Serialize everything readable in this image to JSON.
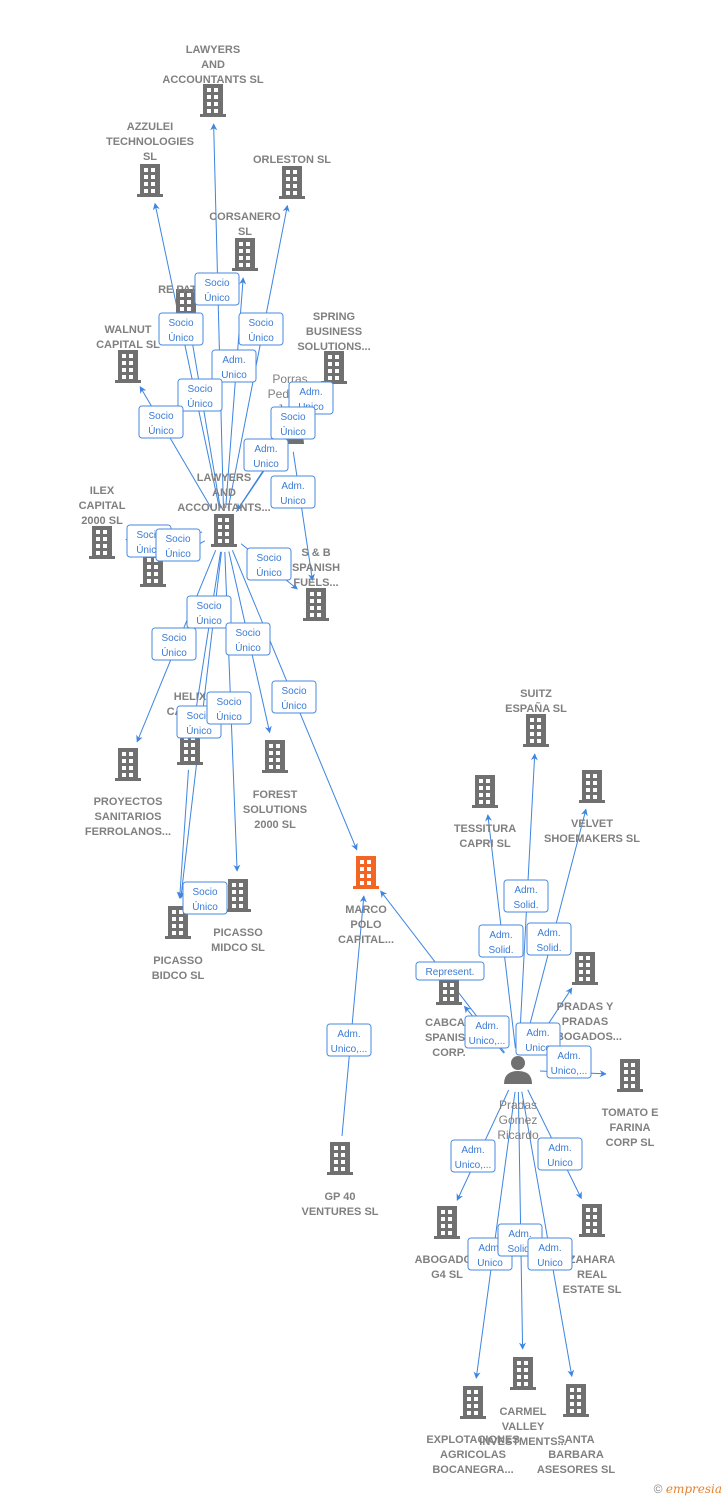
{
  "colors": {
    "node": "#707070",
    "highlight": "#f26522",
    "edge": "#3d85e0"
  },
  "nodes": [
    {
      "id": "lawyers_top",
      "type": "company",
      "lines": [
        "LAWYERS",
        "AND",
        "ACCOUNTANTS SL"
      ]
    },
    {
      "id": "azzulei",
      "type": "company",
      "lines": [
        "AZZULEI",
        "TECHNOLOGIES",
        "SL"
      ]
    },
    {
      "id": "orleston",
      "type": "company",
      "lines": [
        "ORLESTON  SL"
      ]
    },
    {
      "id": "corsanero",
      "type": "company",
      "lines": [
        "CORSANERO",
        "SL"
      ]
    },
    {
      "id": "repat",
      "type": "company",
      "lines": [
        "RE PAT SL"
      ]
    },
    {
      "id": "walnut",
      "type": "company",
      "lines": [
        "WALNUT",
        "CAPITAL  SL"
      ]
    },
    {
      "id": "spring",
      "type": "company",
      "lines": [
        "SPRING",
        "BUSINESS",
        "SOLUTIONS..."
      ]
    },
    {
      "id": "porras",
      "type": "person",
      "lines": [
        "Porras",
        "Pedraza",
        "Juan"
      ]
    },
    {
      "id": "lawyers_mid",
      "type": "company",
      "lines": [
        "LAWYERS",
        "AND",
        "ACCOUNTANTS..."
      ]
    },
    {
      "id": "ilex",
      "type": "company",
      "lines": [
        "ILEX",
        "CAPITAL",
        "2000  SL"
      ]
    },
    {
      "id": "weston",
      "type": "company",
      "lines": [
        "WESTON"
      ]
    },
    {
      "id": "sb",
      "type": "company",
      "lines": [
        "S & B",
        "SPANISH",
        "FUELS..."
      ]
    },
    {
      "id": "helix",
      "type": "company",
      "lines": [
        "HELIX",
        "CAPITAL",
        "2000"
      ]
    },
    {
      "id": "proyectos",
      "type": "company",
      "lines": [
        "PROYECTOS",
        "SANITARIOS",
        "FERROLANOS..."
      ]
    },
    {
      "id": "forest",
      "type": "company",
      "lines": [
        "FOREST",
        "SOLUTIONS",
        "2000  SL"
      ]
    },
    {
      "id": "picasso_midco",
      "type": "company",
      "lines": [
        "PICASSO",
        "MIDCO  SL"
      ]
    },
    {
      "id": "picasso_bidco",
      "type": "company",
      "lines": [
        "PICASSO",
        "BIDCO  SL"
      ]
    },
    {
      "id": "marco",
      "type": "company",
      "highlight": true,
      "lines": [
        "MARCO",
        "POLO",
        "CAPITAL..."
      ]
    },
    {
      "id": "gp40",
      "type": "company",
      "lines": [
        "GP 40",
        "VENTURES  SL"
      ]
    },
    {
      "id": "suitz",
      "type": "company",
      "lines": [
        "SUITZ",
        "ESPAÑA  SL"
      ]
    },
    {
      "id": "tessitura",
      "type": "company",
      "lines": [
        "TESSITURA",
        "CAPRI  SL"
      ]
    },
    {
      "id": "velvet",
      "type": "company",
      "lines": [
        "VELVET",
        "SHOEMAKERS SL"
      ]
    },
    {
      "id": "pradas_y",
      "type": "company",
      "lines": [
        "PRADAS Y",
        "PRADAS",
        "ABOGADOS..."
      ]
    },
    {
      "id": "cabcar",
      "type": "company",
      "lines": [
        "CABCAR",
        "SPANISH",
        "CORP."
      ]
    },
    {
      "id": "pradas_gomez",
      "type": "person",
      "lines": [
        "Pradas",
        "Gomez",
        "Ricardo"
      ]
    },
    {
      "id": "tomato",
      "type": "company",
      "lines": [
        "TOMATO E",
        "FARINA",
        "CORP  SL"
      ]
    },
    {
      "id": "abogado",
      "type": "company",
      "lines": [
        "ABOGADOS",
        "G4  SL"
      ]
    },
    {
      "id": "zahara",
      "type": "company",
      "lines": [
        "ZAHARA",
        "REAL",
        "ESTATE  SL"
      ]
    },
    {
      "id": "carmel",
      "type": "company",
      "lines": [
        "CARMEL",
        "VALLEY",
        "INVESTMENTS..."
      ]
    },
    {
      "id": "explotaciones",
      "type": "company",
      "lines": [
        "EXPLOTACIONES",
        "AGRICOLAS",
        "BOCANEGRA..."
      ]
    },
    {
      "id": "santa",
      "type": "company",
      "lines": [
        "SANTA",
        "BARBARA",
        "ASESORES  SL"
      ]
    }
  ],
  "edges": [
    {
      "from": "lawyers_mid",
      "to": "lawyers_top",
      "lines": [
        "Socio",
        "Único"
      ]
    },
    {
      "from": "lawyers_mid",
      "to": "azzulei",
      "lines": [
        "Socio",
        "Único"
      ]
    },
    {
      "from": "lawyers_mid",
      "to": "orleston",
      "lines": [
        "Socio",
        "Único"
      ]
    },
    {
      "from": "lawyers_mid",
      "to": "corsanero",
      "lines": [
        "Adm.",
        "Unico"
      ]
    },
    {
      "from": "lawyers_mid",
      "to": "repat",
      "lines": [
        "Socio",
        "Único"
      ]
    },
    {
      "from": "lawyers_mid",
      "to": "walnut",
      "lines": [
        "Socio",
        "Único"
      ]
    },
    {
      "from": "porras",
      "to": "spring",
      "lines": [
        "Adm.",
        "Unico"
      ]
    },
    {
      "from": "lawyers_mid",
      "to": "spring",
      "lines": [
        "Socio",
        "Único"
      ]
    },
    {
      "from": "porras",
      "to": "lawyers_mid",
      "lines": [
        "Adm.",
        "Unico"
      ]
    },
    {
      "from": "porras",
      "to": "sb",
      "lines": [
        "Adm.",
        "Unico"
      ]
    },
    {
      "from": "lawyers_mid",
      "to": "ilex",
      "lines": [
        "Socio",
        "Único"
      ]
    },
    {
      "from": "lawyers_mid",
      "to": "weston",
      "lines": [
        "Socio",
        "Único"
      ]
    },
    {
      "from": "lawyers_mid",
      "to": "sb",
      "lines": [
        "Socio",
        "Único"
      ]
    },
    {
      "from": "lawyers_mid",
      "to": "helix",
      "lines": [
        "Socio",
        "Único"
      ]
    },
    {
      "from": "lawyers_mid",
      "to": "proyectos",
      "lines": [
        "Socio",
        "Único"
      ]
    },
    {
      "from": "lawyers_mid",
      "to": "forest",
      "lines": [
        "Socio",
        "Único"
      ]
    },
    {
      "from": "lawyers_mid",
      "to": "picasso_bidco",
      "lines": [
        "Socio",
        "Único"
      ]
    },
    {
      "from": "lawyers_mid",
      "to": "picasso_midco",
      "lines": [
        "Socio",
        "Único"
      ]
    },
    {
      "from": "lawyers_mid",
      "to": "marco",
      "lines": [
        "Socio",
        "Único"
      ]
    },
    {
      "from": "helix",
      "to": "picasso_bidco",
      "lines": [
        "Socio",
        "Único"
      ]
    },
    {
      "from": "gp40",
      "to": "marco",
      "lines": [
        "Adm.",
        "Unico,..."
      ]
    },
    {
      "from": "pradas_gomez",
      "to": "marco",
      "lines": [
        "Represent."
      ]
    },
    {
      "from": "pradas_gomez",
      "to": "suitz",
      "lines": [
        "Adm.",
        "Solid."
      ]
    },
    {
      "from": "pradas_gomez",
      "to": "tessitura",
      "lines": [
        "Adm.",
        "Solid."
      ]
    },
    {
      "from": "pradas_gomez",
      "to": "velvet",
      "lines": [
        "Adm.",
        "Solid."
      ]
    },
    {
      "from": "pradas_gomez",
      "to": "cabcar",
      "lines": [
        "Adm.",
        "Unico,..."
      ]
    },
    {
      "from": "pradas_gomez",
      "to": "pradas_y",
      "lines": [
        "Adm.",
        "Unico"
      ]
    },
    {
      "from": "pradas_gomez",
      "to": "tomato",
      "lines": [
        "Adm.",
        "Unico,..."
      ]
    },
    {
      "from": "pradas_gomez",
      "to": "abogado",
      "lines": [
        "Adm.",
        "Unico,..."
      ]
    },
    {
      "from": "pradas_gomez",
      "to": "zahara",
      "lines": [
        "Adm.",
        "Unico"
      ]
    },
    {
      "from": "pradas_gomez",
      "to": "explotaciones",
      "lines": [
        "Adm.",
        "Unico"
      ]
    },
    {
      "from": "pradas_gomez",
      "to": "carmel",
      "lines": [
        "Adm.",
        "Solid."
      ]
    },
    {
      "from": "pradas_gomez",
      "to": "santa",
      "lines": [
        "Adm.",
        "Unico"
      ]
    }
  ],
  "footer": {
    "copyright": "©",
    "brand": "empresia"
  }
}
